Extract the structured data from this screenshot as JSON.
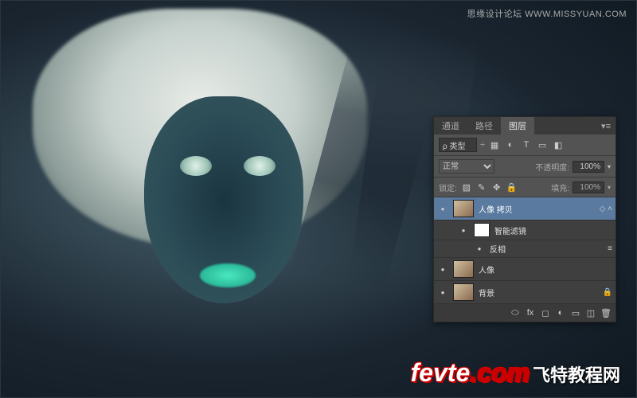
{
  "top_watermark": "思缘设计论坛  WWW.MISSYUAN.COM",
  "panel": {
    "tabs": {
      "channels": "通道",
      "paths": "路径",
      "layers": "图层"
    },
    "filter_placeholder": "ρ 类型",
    "blend_mode": "正常",
    "opacity_label": "不透明度:",
    "opacity_value": "100%",
    "lock_label": "锁定:",
    "fill_label": "填充:",
    "fill_value": "100%"
  },
  "layers": {
    "l1": {
      "name": "人像 拷贝"
    },
    "l2": {
      "name": "智能滤镜"
    },
    "l3": {
      "name": "反相"
    },
    "l4": {
      "name": "人像"
    },
    "l5": {
      "name": "背景"
    }
  },
  "bottom_watermark": {
    "logo_a": "fevte",
    "logo_b": ".com",
    "text": "飞特教程网"
  }
}
